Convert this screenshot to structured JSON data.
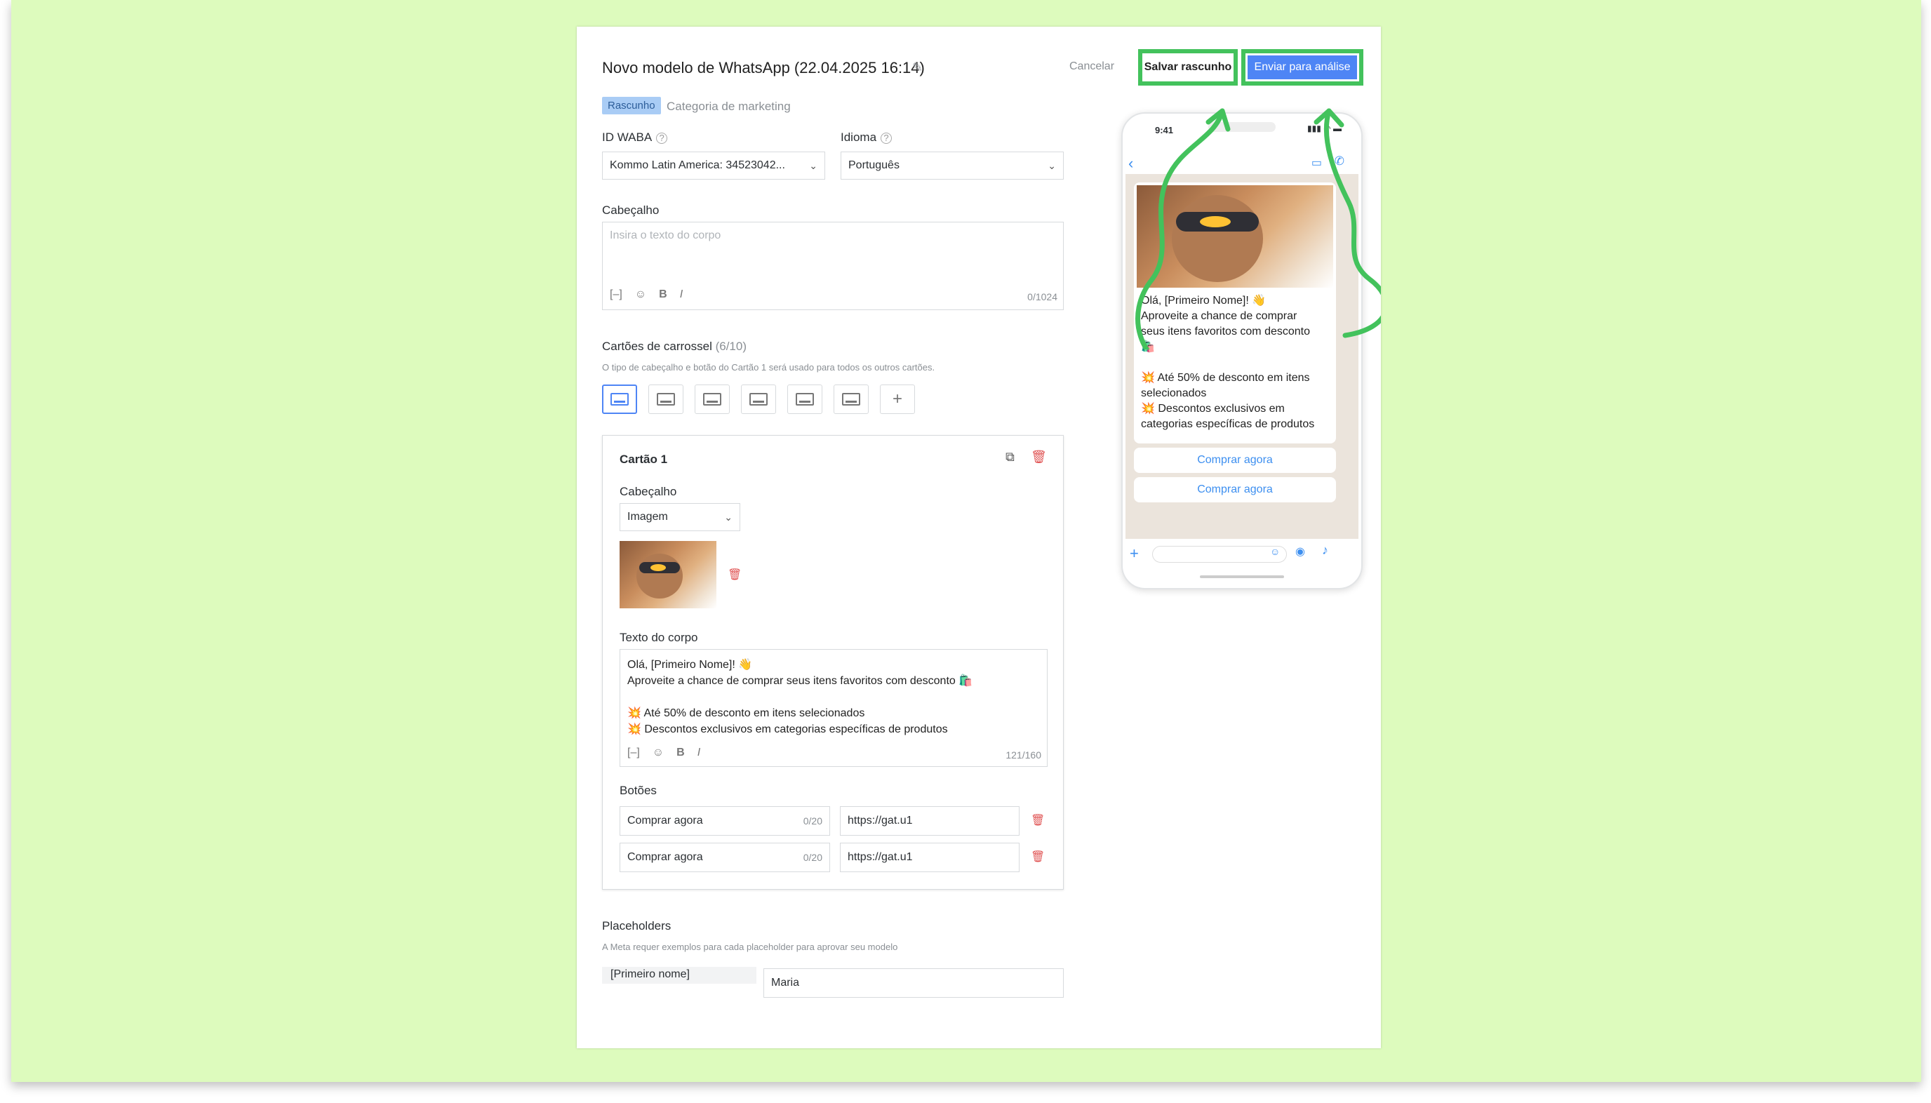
{
  "header": {
    "title": "Novo modelo de WhatsApp (22.04.2025 16:14)",
    "cancel": "Cancelar",
    "save_draft": "Salvar rascunho",
    "submit": "Enviar para análise"
  },
  "status": {
    "badge": "Rascunho",
    "category": "Categoria de marketing"
  },
  "fields": {
    "waba_label": "ID WABA",
    "waba_value": "Kommo Latin America: 34523042...",
    "language_label": "Idioma",
    "language_value": "Português",
    "header_label": "Cabeçalho",
    "header_placeholder": "Insira o texto do corpo",
    "header_counter": "0/1024"
  },
  "carousel": {
    "label": "Cartões de carrossel",
    "count": "(6/10)",
    "hint": "O tipo de cabeçalho e botão do Cartão 1 será usado para todos os outros cartões.",
    "add": "+"
  },
  "card": {
    "title": "Cartão 1",
    "header_label": "Cabeçalho",
    "header_type": "Imagem",
    "body_label": "Texto do corpo",
    "body_lines": [
      "Olá, [Primeiro Nome]! 👋",
      "Aproveite a chance de comprar seus itens favoritos com desconto 🛍️",
      "",
      "💥 Até 50% de desconto em itens selecionados",
      "💥 Descontos exclusivos em categorias específicas de produtos"
    ],
    "body_counter": "121/160",
    "buttons_label": "Botões",
    "buttons": [
      {
        "text": "Comprar agora",
        "counter": "0/20",
        "url": "https://gat.u1"
      },
      {
        "text": "Comprar agora",
        "counter": "0/20",
        "url": "https://gat.u1"
      }
    ]
  },
  "placeholders": {
    "label": "Placeholders",
    "hint": "A Meta requer exemplos para cada placeholder para aprovar seu modelo",
    "name": "[Primeiro nome]",
    "value": "Maria"
  },
  "preview": {
    "time": "9:41",
    "message_lines": [
      "Olá, [Primeiro Nome]! 👋",
      "Aproveite a chance de comprar",
      "seus itens favoritos com desconto",
      "🛍️",
      "",
      "💥 Até 50% de desconto em itens",
      "selecionados",
      "💥 Descontos exclusivos em",
      "categorias específicas de produtos"
    ],
    "buttons": [
      "Comprar agora",
      "Comprar agora"
    ]
  },
  "colors": {
    "background": "#ddfbbd",
    "accent": "#4e85f5",
    "highlight": "#43c25c",
    "danger": "#e05454"
  }
}
